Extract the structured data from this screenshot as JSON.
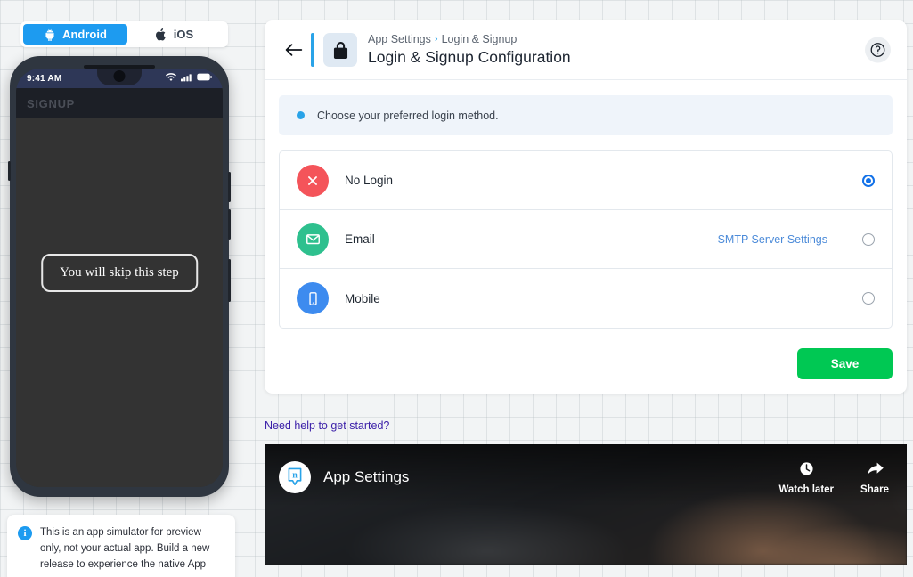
{
  "platform_toggle": {
    "options": [
      {
        "label": "Android",
        "icon": "android-icon",
        "active": true
      },
      {
        "label": "iOS",
        "icon": "apple-icon",
        "active": false
      }
    ]
  },
  "simulator": {
    "status_bar": {
      "time": "9:41 AM",
      "icons": [
        "wifi-icon",
        "cellular-signal-icon",
        "battery-icon"
      ]
    },
    "app_header_title": "SIGNUP",
    "skip_message": "You will skip this step",
    "note": {
      "icon": "info-icon",
      "text": "This is an app simulator for preview only, not your actual app. Build a new release to experience the native App"
    }
  },
  "header": {
    "back_icon": "back-arrow-icon",
    "lock_icon": "lock-icon",
    "breadcrumb": {
      "parent": "App Settings",
      "separator": "›",
      "current": "Login & Signup"
    },
    "title": "Login & Signup Configuration",
    "help_icon": "question-mark-icon"
  },
  "info_banner": {
    "text": "Choose your preferred login method."
  },
  "options": [
    {
      "label": "No Login",
      "icon": "close-circle-icon",
      "icon_color": "#f4545a",
      "selected": true,
      "link": null
    },
    {
      "label": "Email",
      "icon": "envelope-icon",
      "icon_color": "#2ec08e",
      "selected": false,
      "link": "SMTP Server Settings"
    },
    {
      "label": "Mobile",
      "icon": "mobile-phone-icon",
      "icon_color": "#3d8bef",
      "selected": false,
      "link": null
    }
  ],
  "actions": {
    "save_label": "Save",
    "save_color": "#00c853"
  },
  "help_section": {
    "link_text": "Need help to get started?"
  },
  "video": {
    "channel_avatar_letter": "n",
    "title": "App Settings",
    "watch_later_label": "Watch later",
    "watch_later_icon": "clock-icon",
    "share_label": "Share",
    "share_icon": "share-arrow-icon"
  },
  "colors": {
    "accent_blue": "#29a3e8",
    "android_blue": "#1d9bf0",
    "link_blue": "#4c8bd9",
    "radio_blue": "#1271e8",
    "help_link_purple": "#3b1fa8"
  }
}
